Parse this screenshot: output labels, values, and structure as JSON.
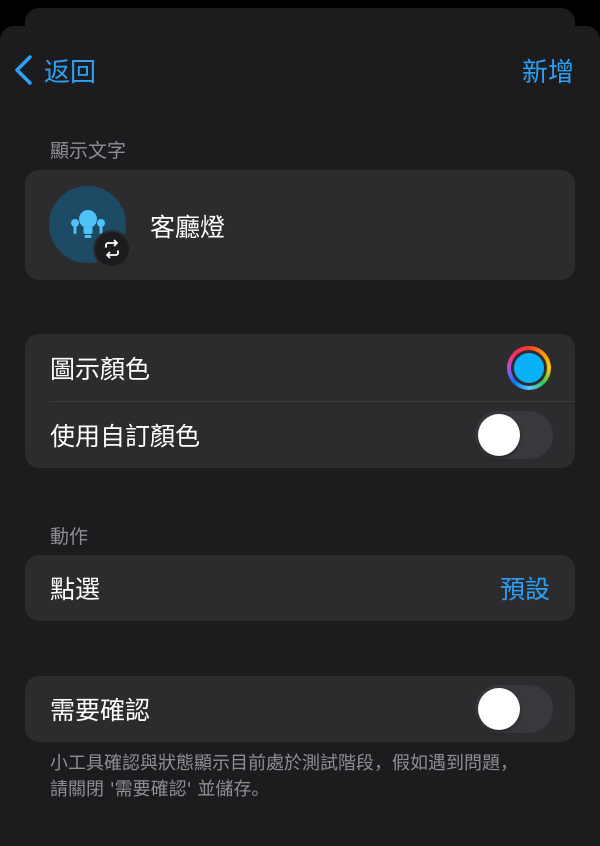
{
  "nav": {
    "back_label": "返回",
    "add_label": "新增"
  },
  "display_section": {
    "label": "顯示文字",
    "name": "客廳燈",
    "icon": "light-bulb-icon",
    "badge_icon": "swap-icon"
  },
  "color_section": {
    "icon_color_label": "圖示顏色",
    "icon_color_value": "#0ab0f5",
    "custom_color_label": "使用自訂顏色",
    "custom_color_on": false
  },
  "action_section": {
    "label": "動作",
    "tap_label": "點選",
    "tap_value": "預設"
  },
  "confirm_section": {
    "require_label": "需要確認",
    "require_on": false,
    "note": "小工具確認與狀態顯示目前處於測試階段，假如遇到問題，請關閉 '需要確認' 並儲存。"
  },
  "colors": {
    "accent": "#2d9ff5",
    "card": "#2c2c2e",
    "sheet": "#1c1c1e",
    "icon_bg": "#1d4b66"
  }
}
